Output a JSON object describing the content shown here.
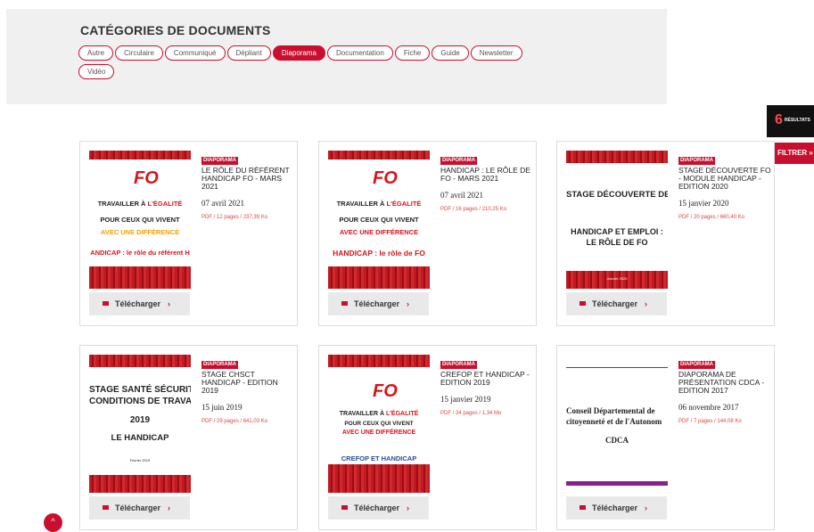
{
  "categories": {
    "title": "CATÉGORIES DE DOCUMENTS",
    "items": [
      {
        "label": "Autre"
      },
      {
        "label": "Circulaire"
      },
      {
        "label": "Communiqué"
      },
      {
        "label": "Dépliant"
      },
      {
        "label": "Diaporama",
        "active": true
      },
      {
        "label": "Documentation"
      },
      {
        "label": "Fiche"
      },
      {
        "label": "Guide"
      },
      {
        "label": "Newsletter"
      },
      {
        "label": "Vidéo"
      }
    ]
  },
  "results": {
    "count": "6",
    "label": "RÉSULTATS"
  },
  "filter": {
    "label": "FILTRER »"
  },
  "documents": [
    {
      "badge": "DIAPORAMA",
      "title": "LE RÔLE DU RÉFÉRENT HANDICAP FO - MARS 2021",
      "date": "07 avril 2021",
      "meta": "PDF / 12 pages / 237,39 Ko",
      "thumb": {
        "fo": "FO",
        "l1a": "TRAVAILLER À ",
        "l1b": "L'ÉGALITÉ",
        "l2": "POUR CEUX QUI VIVENT",
        "l3": "AVEC UNE DIFFÉRENCE",
        "l4": "ANDICAP : le rôle du référent H"
      }
    },
    {
      "badge": "DIAPORAMA",
      "title": "HANDICAP : LE RÔLE DE FO - MARS 2021",
      "date": "07 avril 2021",
      "meta": "PDF / 16 pages / 210,25 Ko",
      "thumb": {
        "fo": "FO",
        "l1a": "TRAVAILLER À ",
        "l1b": "L'ÉGALITÉ",
        "l2": "POUR CEUX QUI VIVENT",
        "l3": "AVEC UNE DIFFÉRENCE",
        "l4": "HANDICAP : le rôle de FO"
      }
    },
    {
      "badge": "DIAPORAMA",
      "title": "STAGE DÉCOUVERTE FO - MODULE HANDICAP - EDITION 2020",
      "date": "15 janvier 2020",
      "meta": "PDF / 20 pages / 660,40 Ko",
      "thumb": {
        "l1": "STAGE DÉCOUVERTE DE F",
        "l2": "HANDICAP ET EMPLOI :",
        "l3": "LE RÔLE DE FO",
        "foot": "Janvier 2020"
      }
    },
    {
      "badge": "DIAPORAMA",
      "title": "STAGE CHSCT HANDICAP - EDITION 2019",
      "date": "15 juin 2019",
      "meta": "PDF / 29 pages / 641,03 Ko",
      "thumb": {
        "l1": "STAGE SANTÉ SÉCURITÉ",
        "l2": "CONDITIONS DE TRAVAI",
        "l3": "2019",
        "l4": "LE HANDICAP",
        "foot": "Février 2019"
      }
    },
    {
      "badge": "DIAPORAMA",
      "title": "CREFOP ET HANDICAP - EDITION 2019",
      "date": "15 janvier 2019",
      "meta": "PDF / 34 pages / 1,34 Mo",
      "thumb": {
        "fo": "FO",
        "l1a": "TRAVAILLER À ",
        "l1b": "L'ÉGALITÉ",
        "l2": "POUR CEUX QUI VIVENT",
        "l3": "AVEC UNE DIFFÉRENCE",
        "l4": "CREFOP ET HANDICAP"
      }
    },
    {
      "badge": "DIAPORAMA",
      "title": "DIAPORAMA DE PRÉSENTATION CDCA - EDITION 2017",
      "date": "06 novembre 2017",
      "meta": "PDF / 7 pages / 144,08 Ko",
      "thumb": {
        "l1": "Conseil Départemental de",
        "l2": "citoyenneté et de l'Autonom",
        "l3": "CDCA"
      }
    }
  ],
  "download_label": "Télécharger",
  "download_chevron": "›",
  "scroll_top_icon": "^",
  "colors": {
    "accent": "#c8102e",
    "panel": "#f0f0f0",
    "results_bg": "#111111"
  }
}
